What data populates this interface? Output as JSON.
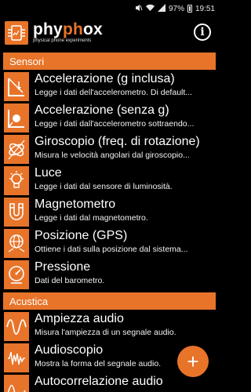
{
  "status_bar": {
    "mute_icon": "mute-icon",
    "wifi_icon": "wifi-icon",
    "signal_icon": "signal-icon",
    "battery_percent": "97%",
    "time": "19:51"
  },
  "app": {
    "name_prefix": "phy",
    "name_accent": "ph",
    "name_suffix": "ox",
    "tagline": "physical phone experiments",
    "info_label": "i"
  },
  "sections": [
    {
      "title": "Sensori",
      "items": [
        {
          "icon": "accelerometer-g-icon",
          "title": "Accelerazione (g inclusa)",
          "desc": "Legge i dati dell'accelerometro. Di default..."
        },
        {
          "icon": "accelerometer-icon",
          "title": "Accelerazione (senza g)",
          "desc": "Legge i dati dall'accelerometro sottraendo..."
        },
        {
          "icon": "gyroscope-icon",
          "title": "Giroscopio (freq. di rotazione)",
          "desc": "Misura le velocità angolari dal giroscopio..."
        },
        {
          "icon": "light-bulb-icon",
          "title": "Luce",
          "desc": "Legge i dati dal sensore di luminosità."
        },
        {
          "icon": "magnet-icon",
          "title": "Magnetometro",
          "desc": "Legge i dati dal magnetometro."
        },
        {
          "icon": "gps-globe-icon",
          "title": "Posizione (GPS)",
          "desc": "Ottiene i dati sulla posizione dal sistema..."
        },
        {
          "icon": "barometer-icon",
          "title": "Pressione",
          "desc": "Dati del barometro."
        }
      ]
    },
    {
      "title": "Acustica",
      "items": [
        {
          "icon": "sine-wave-icon",
          "title": "Ampiezza audio",
          "desc": "Misura l'ampiezza di un segnale audio."
        },
        {
          "icon": "oscilloscope-icon",
          "title": "Audioscopio",
          "desc": "Mostra la forma del segnale audio."
        },
        {
          "icon": "autocorrelation-icon",
          "title": "Autocorrelazione audio",
          "desc": ""
        }
      ]
    }
  ],
  "fab_label": "+",
  "colors": {
    "accent": "#e8742a",
    "background": "#000000"
  }
}
